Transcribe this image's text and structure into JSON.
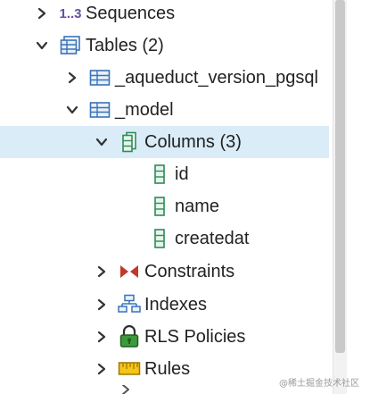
{
  "tree": {
    "sequences_label": "Sequences",
    "sequences_glyph": "1..3",
    "tables_label": "Tables (2)",
    "table_aqueduct_label": "_aqueduct_version_pgsql",
    "table_model_label": "_model",
    "columns_label": "Columns (3)",
    "columns": [
      {
        "label": "id"
      },
      {
        "label": "name"
      },
      {
        "label": "createdat"
      }
    ],
    "constraints_label": "Constraints",
    "indexes_label": "Indexes",
    "rls_label": "RLS Policies",
    "rules_label": "Rules"
  },
  "colors": {
    "selection_bg": "#d9ecf7",
    "table_icon_blue": "#3a73b8",
    "column_icon_green": "#2e8b57",
    "constraint_red": "#c0392b",
    "rls_green": "#3c9a3c",
    "rules_yellow": "#e0a800"
  },
  "icons": {
    "sequences": "sequence-icon",
    "tables": "tables-icon",
    "table": "table-icon",
    "columns": "columns-icon",
    "column": "column-icon",
    "constraints": "constraints-icon",
    "indexes": "indexes-icon",
    "rls": "rls-lock-icon",
    "rules": "rules-icon"
  },
  "watermark": "@稀土掘金技术社区"
}
